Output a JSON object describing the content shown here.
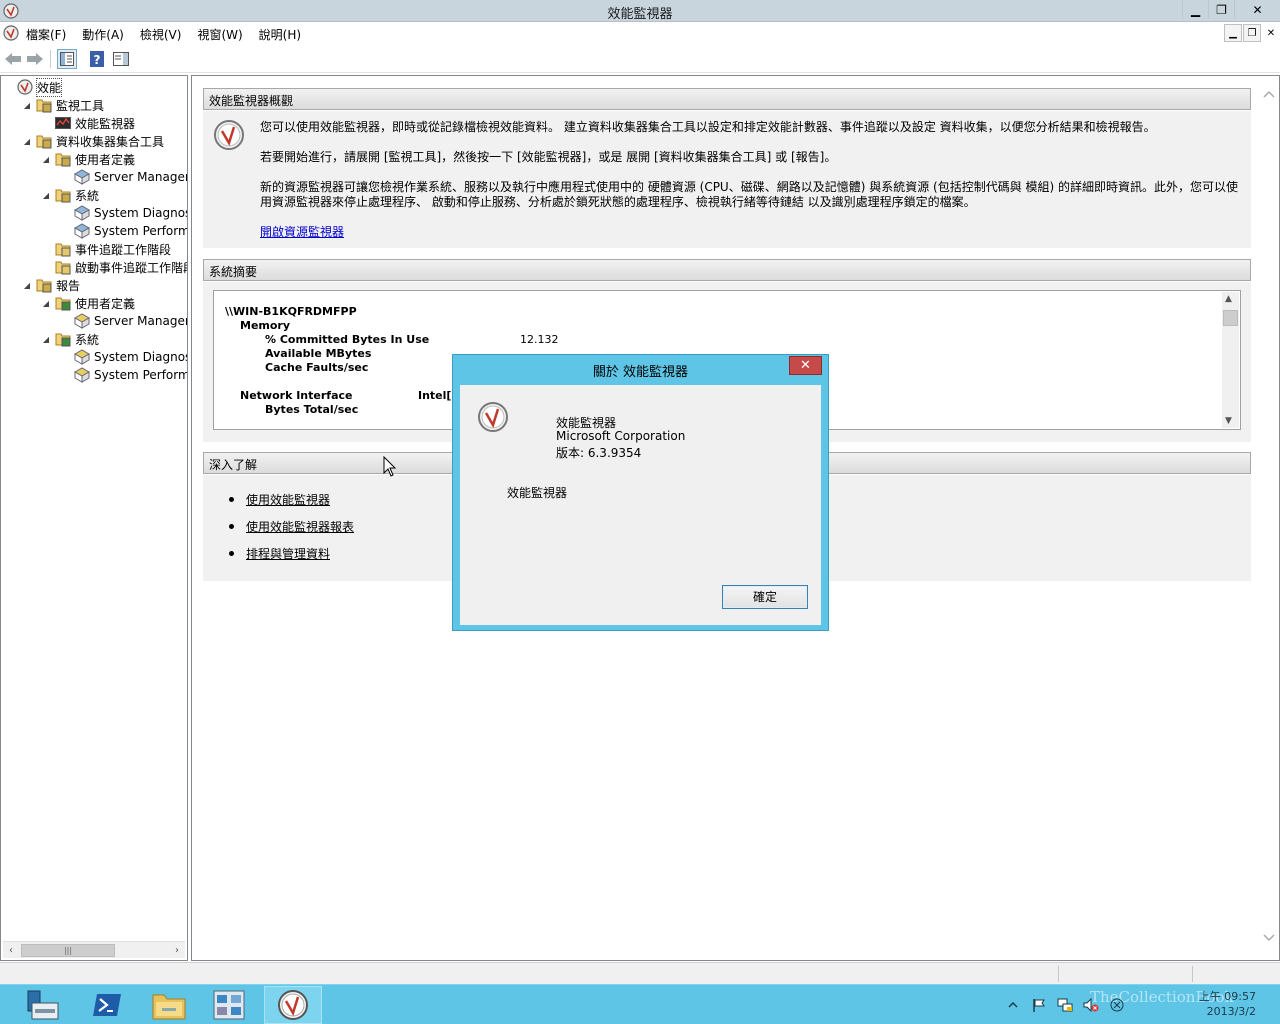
{
  "window": {
    "title": "效能監視器",
    "minimize": "▁",
    "restore": "❐",
    "close": "✕"
  },
  "menu": {
    "items": [
      "檔案(F)",
      "動作(A)",
      "檢視(V)",
      "視窗(W)",
      "說明(H)"
    ],
    "mdi_minimize": "▁",
    "mdi_restore": "❐",
    "mdi_close": "✕"
  },
  "tree": {
    "items": [
      {
        "label": "效能",
        "level": 0,
        "exp": ""
      },
      {
        "label": "監視工具",
        "level": 1,
        "exp": "◢"
      },
      {
        "label": "效能監視器",
        "level": 2,
        "exp": ""
      },
      {
        "label": "資料收集器集合工具",
        "level": 1,
        "exp": "◢"
      },
      {
        "label": "使用者定義",
        "level": 2,
        "exp": "◢"
      },
      {
        "label": "Server Manager Pe",
        "level": 3,
        "exp": ""
      },
      {
        "label": "系統",
        "level": 2,
        "exp": "◢"
      },
      {
        "label": "System Diagnostic",
        "level": 3,
        "exp": ""
      },
      {
        "label": "System Performan",
        "level": 3,
        "exp": ""
      },
      {
        "label": "事件追蹤工作階段",
        "level": 2,
        "exp": ""
      },
      {
        "label": "啟動事件追蹤工作階段",
        "level": 2,
        "exp": ""
      },
      {
        "label": "報告",
        "level": 1,
        "exp": "◢"
      },
      {
        "label": "使用者定義",
        "level": 2,
        "exp": "◢"
      },
      {
        "label": "Server Manager Pe",
        "level": 3,
        "exp": ""
      },
      {
        "label": "系統",
        "level": 2,
        "exp": "◢"
      },
      {
        "label": "System Diagnostic",
        "level": 3,
        "exp": ""
      },
      {
        "label": "System Performan",
        "level": 3,
        "exp": ""
      }
    ],
    "scroll_left": "‹",
    "scroll_right": "›",
    "scroll_grip": "|||"
  },
  "overview": {
    "header": "效能監視器概觀",
    "p1": "您可以使用效能監視器，即時或從記錄檔檢視效能資料。 建立資料收集器集合工具以設定和排定效能計數器、事件追蹤以及設定 資料收集，以便您分析結果和檢視報告。",
    "p2": "若要開始進行，請展開 [監視工具]，然後按一下 [效能監視器]，或是 展開 [資料收集器集合工具] 或 [報告]。",
    "p3": "新的資源監視器可讓您檢視作業系統、服務以及執行中應用程式使用中的 硬體資源 (CPU、磁碟、網路以及記憶體) 與系統資源 (包括控制代碼與 模組) 的詳細即時資訊。此外，您可以使用資源監視器來停止處理程序、 啟動和停止服務、分析處於鎖死狀態的處理程序、檢視執行緒等待鏈結 以及識別處理程序鎖定的檔案。",
    "link": "開啟資源監視器"
  },
  "summary": {
    "header": "系統摘要",
    "machine": "\\\\WIN-B1KQFRDMFPP",
    "memory": "Memory",
    "committed": "% Committed Bytes In Use",
    "committed_value": "12.132",
    "available": "Available MBytes",
    "cache": "Cache Faults/sec",
    "network": "Network Interface",
    "network_adapter": "Intel[R",
    "bytes_total": "Bytes Total/sec",
    "scroll_up": "▲",
    "scroll_down": "▼"
  },
  "learn": {
    "header": "深入了解",
    "links": [
      "使用效能監視器",
      "使用效能監視器報表",
      "排程與管理資料"
    ]
  },
  "dialog": {
    "title": "關於 效能監視器",
    "close": "✕",
    "product": "效能監視器",
    "company": "Microsoft Corporation",
    "version": "版本: 6.3.9354",
    "description": "效能監視器",
    "ok": "確定"
  },
  "taskbar": {
    "clock_time": "上午 09:57",
    "clock_date": "2013/3/2",
    "watermark": "TheCollectionBook"
  },
  "colors": {
    "taskbar": "#5ec5e6",
    "dialog_frame": "#5ec5e6",
    "close_red": "#c74a4a",
    "link": "#0000cc"
  }
}
